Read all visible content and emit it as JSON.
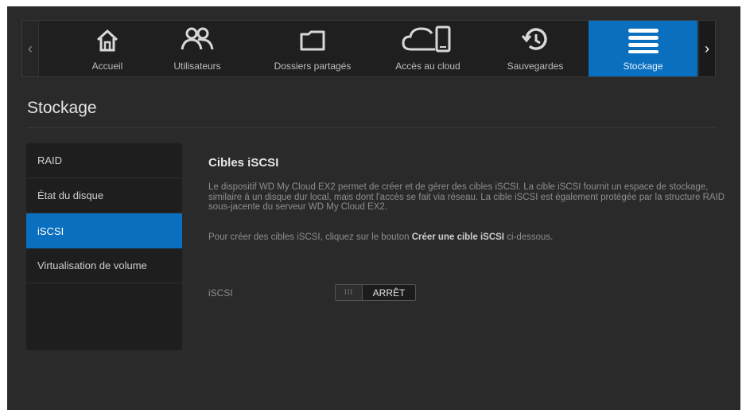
{
  "nav": {
    "prev_arrow": "‹",
    "next_arrow": "›",
    "items": [
      {
        "label": "Accueil",
        "icon": "home-icon"
      },
      {
        "label": "Utilisateurs",
        "icon": "users-icon"
      },
      {
        "label": "Dossiers partagés",
        "icon": "folder-icon"
      },
      {
        "label": "Accès au cloud",
        "icon": "cloud-device-icon"
      },
      {
        "label": "Sauvegardes",
        "icon": "backup-icon"
      },
      {
        "label": "Stockage",
        "icon": "storage-icon",
        "active": true
      }
    ]
  },
  "page": {
    "title": "Stockage"
  },
  "sidebar": {
    "items": [
      {
        "label": "RAID"
      },
      {
        "label": "État du disque"
      },
      {
        "label": "iSCSI",
        "active": true
      },
      {
        "label": "Virtualisation de volume"
      }
    ]
  },
  "main": {
    "section_title": "Cibles iSCSI",
    "description": "Le dispositif WD My Cloud EX2 permet de créer et de gérer des cibles iSCSI. La cible iSCSI fournit un espace de stockage, similaire à un disque dur local, mais dont l'accès se fait via réseau. La cible iSCSI est également protégée par la structure RAID sous-jacente du serveur WD My Cloud EX2.",
    "instruction_prefix": "Pour créer des cibles iSCSI, cliquez sur le bouton ",
    "instruction_bold": "Créer une cible iSCSI",
    "instruction_suffix": " ci-dessous.",
    "field_label": "iSCSI",
    "toggle_grip": "III",
    "toggle_state": "ARRÊT"
  },
  "colors": {
    "accent": "#0a6fbf",
    "background": "#2a2a2a",
    "sidebar": "#1e1e1e"
  }
}
